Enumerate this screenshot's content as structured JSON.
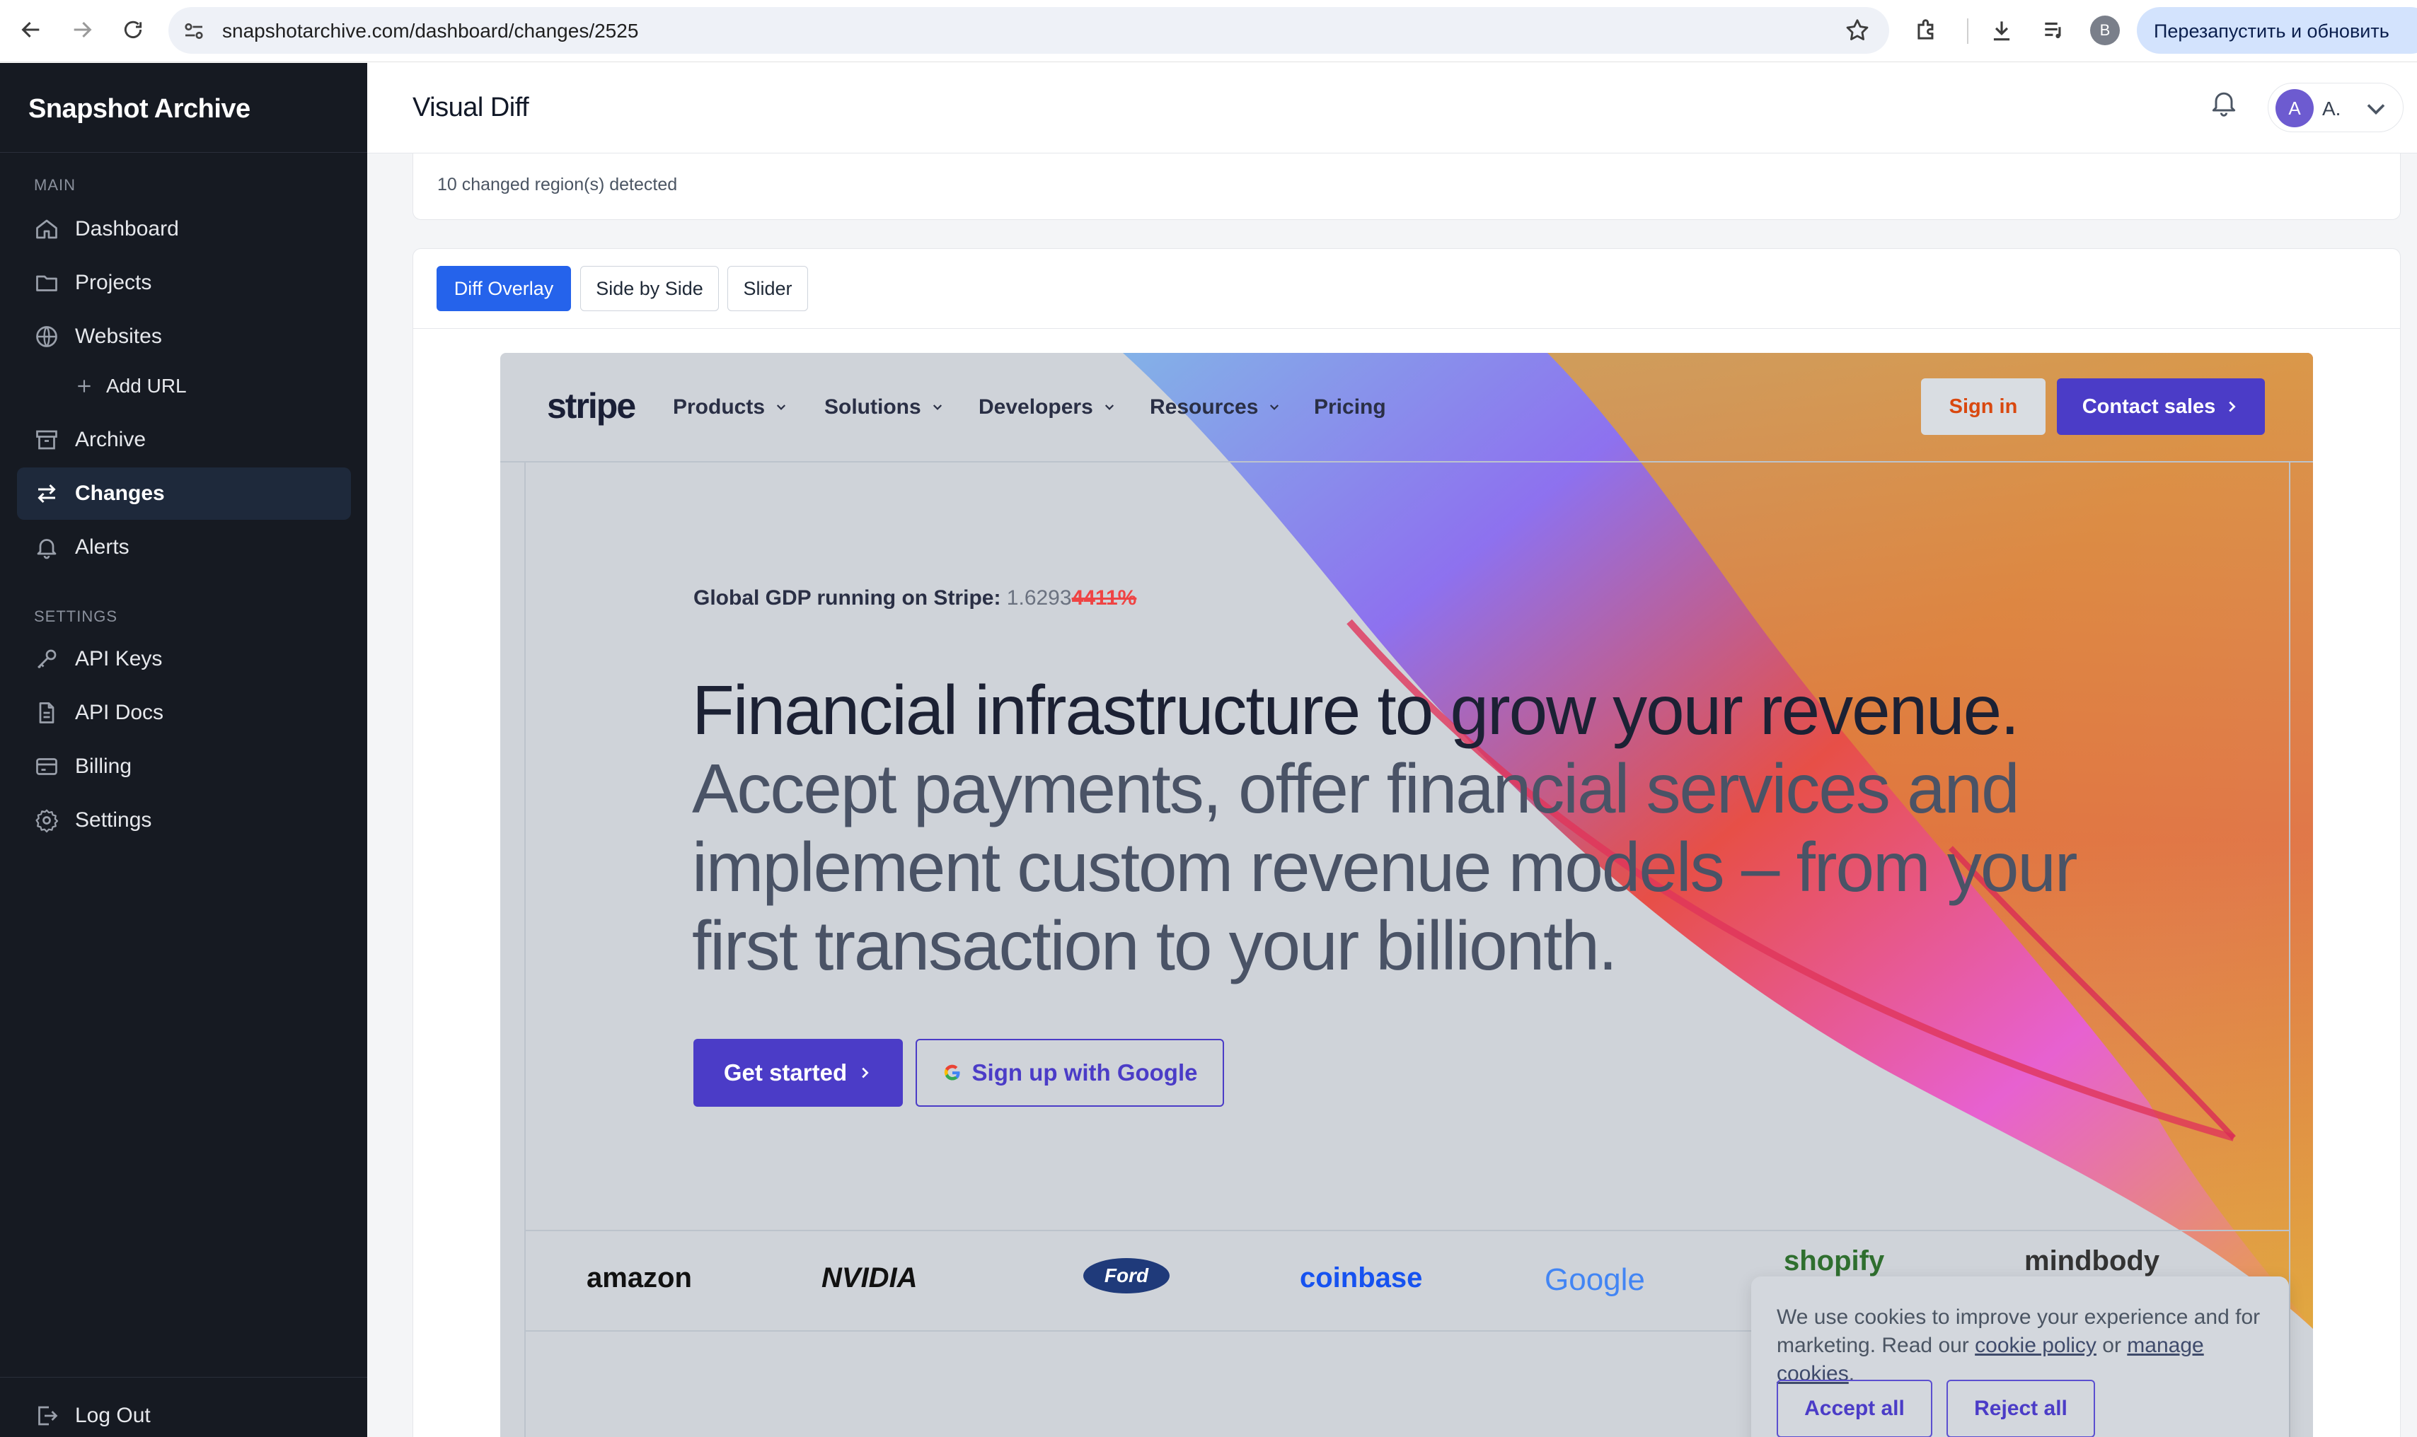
{
  "browser": {
    "url": "snapshotarchive.com/dashboard/changes/2525",
    "profile_initial": "B",
    "restart_label": "Перезапустить и обновить"
  },
  "sidebar": {
    "brand": "Snapshot Archive",
    "main_label": "MAIN",
    "settings_label": "SETTINGS",
    "items": [
      {
        "label": "Dashboard",
        "icon": "home-icon"
      },
      {
        "label": "Projects",
        "icon": "folder-icon"
      },
      {
        "label": "Websites",
        "icon": "globe-icon"
      },
      {
        "label": "Add URL",
        "icon": "plus-icon"
      },
      {
        "label": "Archive",
        "icon": "archive-icon"
      },
      {
        "label": "Changes",
        "icon": "arrows-exchange-icon"
      },
      {
        "label": "Alerts",
        "icon": "bell-icon"
      }
    ],
    "settings_items": [
      {
        "label": "API Keys",
        "icon": "key-icon"
      },
      {
        "label": "API Docs",
        "icon": "document-icon"
      },
      {
        "label": "Billing",
        "icon": "credit-card-icon"
      },
      {
        "label": "Settings",
        "icon": "gear-icon"
      }
    ],
    "logout_label": "Log Out",
    "active": "Changes"
  },
  "topbar": {
    "title": "Visual Diff",
    "user_initial": "A",
    "user_name": "A."
  },
  "summary": {
    "text": "10 changed region(s) detected"
  },
  "viewer": {
    "tabs": [
      "Diff Overlay",
      "Side by Side",
      "Slider"
    ],
    "active_tab": "Diff Overlay"
  },
  "capture": {
    "logo": "stripe",
    "nav": [
      "Products",
      "Solutions",
      "Developers",
      "Resources",
      "Pricing"
    ],
    "signin": "Sign in",
    "contact": "Contact sales",
    "gdp_label": "Global GDP running on Stripe:",
    "gdp_value": "1.6293",
    "gdp_changed": "4411%",
    "headline_main": "Financial infrastructure to grow your revenue.",
    "headline_sub": "Accept payments, offer financial services and implement custom revenue models – from your first transaction to your billionth.",
    "cta_primary": "Get started",
    "cta_google": "Sign up with Google",
    "logos": [
      "amazon",
      "NVIDIA",
      "Ford",
      "coinbase",
      "Google",
      "shopify",
      "mindbody"
    ],
    "accent_color": "#4b3cc7"
  },
  "cookie": {
    "text_before": "We use cookies to improve your experience and for marketing. Read our",
    "link_policy": "cookie policy",
    "text_or": "or",
    "link_manage": "manage cookies",
    "accept": "Accept all",
    "reject": "Reject all"
  }
}
